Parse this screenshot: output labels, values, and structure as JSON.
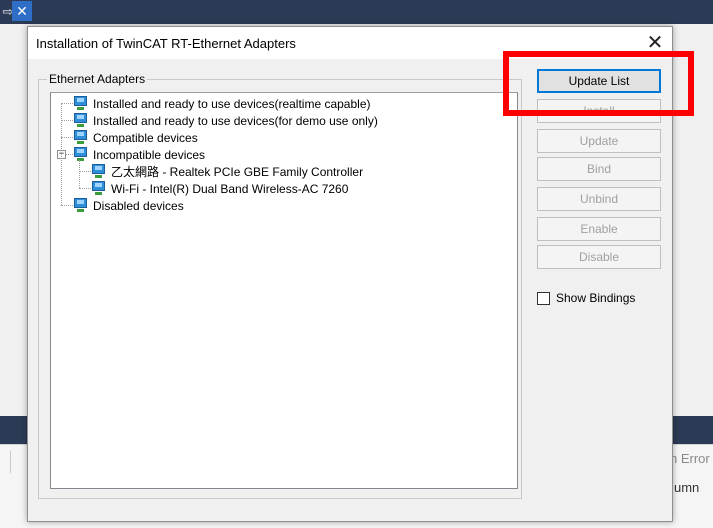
{
  "background": {
    "fragment_right_1": "h Error",
    "fragment_right_2": "umn",
    "topbar_glyph": "⇨",
    "close_glyph": "✕"
  },
  "dialog": {
    "title": "Installation of TwinCAT RT-Ethernet Adapters",
    "close_glyph": "✕",
    "group_label": "Ethernet Adapters",
    "tree": [
      {
        "label": "Installed and ready to use devices(realtime capable)",
        "icon": "network-adapter-icon",
        "level": 0
      },
      {
        "label": "Installed and ready to use devices(for demo use only)",
        "icon": "network-adapter-icon",
        "level": 0
      },
      {
        "label": "Compatible devices",
        "icon": "network-adapter-icon",
        "level": 0
      },
      {
        "label": "Incompatible devices",
        "icon": "network-adapter-icon",
        "level": 0,
        "expanded": true,
        "expander": "−"
      },
      {
        "label": "乙太網路 - Realtek PCIe GBE Family Controller",
        "icon": "network-adapter-icon",
        "level": 1
      },
      {
        "label": "Wi-Fi - Intel(R) Dual Band Wireless-AC 7260",
        "icon": "network-adapter-icon",
        "level": 1
      },
      {
        "label": "Disabled devices",
        "icon": "network-adapter-icon",
        "level": 0
      }
    ],
    "buttons": {
      "update_list": "Update List",
      "install": "Install",
      "update": "Update",
      "bind": "Bind",
      "unbind": "Unbind",
      "enable": "Enable",
      "disable": "Disable"
    },
    "show_bindings": {
      "label": "Show Bindings",
      "checked": false
    }
  },
  "colors": {
    "annotation_red": "#ff0000",
    "ide_dark": "#2b3a55",
    "accent_blue": "#0078d7"
  }
}
